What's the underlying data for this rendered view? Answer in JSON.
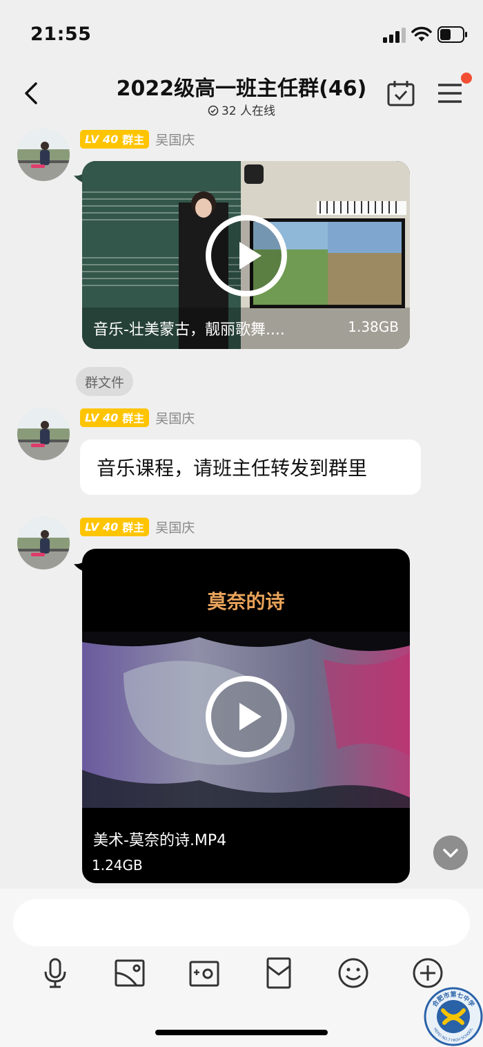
{
  "status_bar": {
    "time": "21:55"
  },
  "header": {
    "title": "2022级高一班主任群(46)",
    "online": "32 人在线",
    "has_notification": true
  },
  "messages": [
    {
      "type": "video",
      "level": "LV 40",
      "role": "群主",
      "sender": "吴国庆",
      "caption": "音乐-壮美蒙古，靓丽歌舞....",
      "size": "1.38GB"
    },
    {
      "type": "chip",
      "label": "群文件"
    },
    {
      "type": "text",
      "level": "LV 40",
      "role": "群主",
      "sender": "吴国庆",
      "text": "音乐课程，请班主任转发到群里"
    },
    {
      "type": "video",
      "level": "LV 40",
      "role": "群主",
      "sender": "吴国庆",
      "video_title": "莫奈的诗",
      "caption": "美术-莫奈的诗.MP4",
      "size": "1.24GB"
    }
  ],
  "composer": {
    "value": "",
    "placeholder": ""
  },
  "toolbar": [
    "mic-icon",
    "image-icon",
    "camera-icon",
    "red-packet-icon",
    "emoji-icon",
    "plus-icon"
  ],
  "watermark": {
    "text": "合肥市第七中学",
    "subtext": "HEFEI NO.7 HIGH SCHOOL"
  },
  "colors": {
    "badge": "#ffc400",
    "notify_dot": "#f24e33",
    "background": "#efefef"
  }
}
